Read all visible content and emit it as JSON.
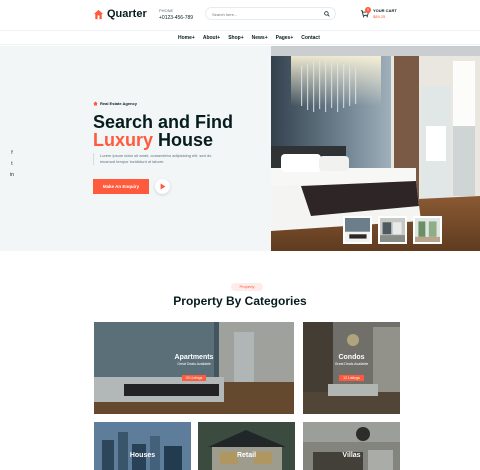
{
  "header": {
    "logo_text": "Quarter",
    "phone_label": "PHONE",
    "phone_number": "+0123-456-789",
    "search_placeholder": "Search here...",
    "cart_label": "YOUR CART",
    "cart_amount": "$89.25",
    "cart_count": "0"
  },
  "nav": {
    "items": [
      {
        "label": "Home"
      },
      {
        "label": "About"
      },
      {
        "label": "Shop"
      },
      {
        "label": "News"
      },
      {
        "label": "Pages"
      },
      {
        "label": "Contact"
      }
    ]
  },
  "hero": {
    "tag": "Real Estate Agency",
    "title_line1": "Search and Find",
    "title_accent": "Luxury",
    "title_rest": " House",
    "description": "Lorem ipsum dolor sit amet, consectetur adipisicing elit, sed do eiusmod tempor incididunt ut labore.",
    "cta_label": "Make An Enquiry"
  },
  "social": [
    {
      "icon": "facebook-icon",
      "glyph": "f"
    },
    {
      "icon": "twitter-icon",
      "glyph": "t"
    },
    {
      "icon": "linkedin-icon",
      "glyph": "in"
    }
  ],
  "categories": {
    "pill": "Property",
    "title": "Property By Categories",
    "cards": [
      {
        "name": "Apartments",
        "sub": "Great Deals Available",
        "badge": "03 Listings"
      },
      {
        "name": "Condos",
        "sub": "Great Deals Available",
        "badge": "12 Listings"
      },
      {
        "name": "Houses",
        "sub": "",
        "badge": ""
      },
      {
        "name": "Retail",
        "sub": "",
        "badge": ""
      },
      {
        "name": "Villas",
        "sub": "",
        "badge": ""
      }
    ]
  },
  "colors": {
    "accent": "#ff5a3c",
    "heading": "#071c1f",
    "hero_bg": "#f2f6f7"
  }
}
